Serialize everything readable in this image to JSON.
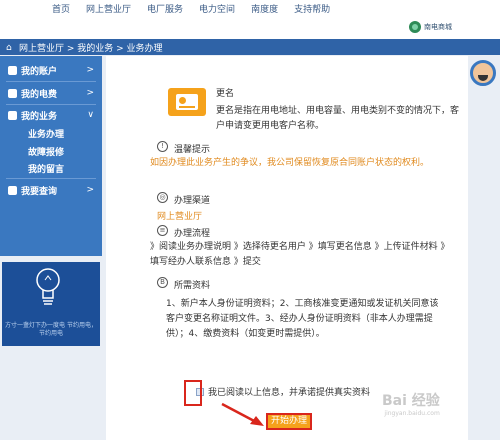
{
  "topnav": {
    "items": [
      "首页",
      "网上营业厅",
      "电厂服务",
      "电力空间",
      "南度度",
      "支持帮助"
    ]
  },
  "brand": {
    "name": "南电商城"
  },
  "breadcrumb": {
    "text": "网上营业厅 > 我的业务 > 业务办理"
  },
  "sidebar": {
    "items": [
      {
        "label": "我的账户",
        "chevron": ">"
      },
      {
        "label": "我的电费",
        "chevron": ">"
      },
      {
        "label": "我的业务",
        "chevron": "∨"
      },
      {
        "label": "我要查询",
        "chevron": ">"
      }
    ],
    "subitems": [
      "业务办理",
      "故障报修",
      "我的留言"
    ],
    "promo_text": "方寸一盏灯下办一度电 节约用电，节约用电"
  },
  "service": {
    "title": "更名",
    "description": "更名是指在用电地址、用电容量、用电类别不变的情况下，客户申请变更用电客户名称。"
  },
  "sections": {
    "tips_label": "温馨提示",
    "tips_text": "如因办理此业务产生的争议，我公司保留恢复原合同账户状态的权利。",
    "channel_label": "办理渠道",
    "channel_text": "网上营业厅",
    "flow_label": "办理流程",
    "flow_text": "》阅读业务办理说明 》选择待更名用户 》填写更名信息 》上传证件材料 》填写经办人联系信息 》提交",
    "docs_label": "所需资料",
    "docs_text": "1、新户本人身份证明资料；2、工商核准变更通知或发证机关同意该客户变更名称证明文件。3、经办人身份证明资料（非本人办理需提供）；4、缴费资料（如变更时需提供）。"
  },
  "agree": {
    "text": "我已阅读以上信息，并承诺提供真实资料"
  },
  "start_button": {
    "label": "开始办理"
  },
  "watermark": {
    "text": "Bai 经验",
    "sub": "jingyan.baidu.com"
  },
  "colors": {
    "accent_blue": "#3a78c0",
    "header_blue": "#2f63a7",
    "orange": "#f5a21b",
    "highlight_red": "#d9261c",
    "warning_text": "#e08a1e"
  }
}
